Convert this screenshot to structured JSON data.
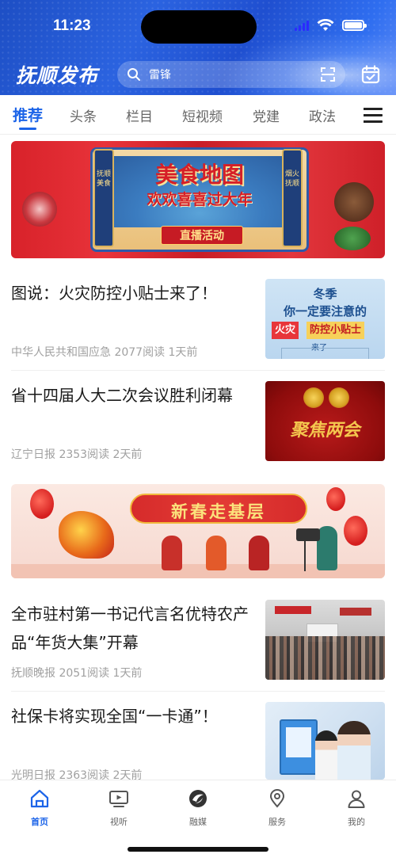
{
  "status_bar": {
    "time": "11:23"
  },
  "header": {
    "logo_text": "抚顺发布",
    "search": {
      "query": "雷锋",
      "icon": "search-icon"
    },
    "scan_icon": "scan-icon",
    "calendar_icon": "calendar-check-icon"
  },
  "tabs": {
    "items": [
      "推荐",
      "头条",
      "栏目",
      "短视频",
      "党建",
      "政法"
    ],
    "active_index": 0,
    "menu_icon": "menu-list-icon",
    "accent_color": "#1c64e8"
  },
  "feed": {
    "banner1": {
      "title": "美食地图",
      "subtitle": "欢欢喜喜过大年",
      "ribbon": "直播活动",
      "side_left": "抚顺美食",
      "side_right": "烟火抚顺"
    },
    "articles": [
      {
        "title": "图说：火灾防控小贴士来了！",
        "meta": "中华人民共和国应急 2077阅读 1天前",
        "thumb": {
          "line1": "冬季",
          "line2": "你一定要注意的",
          "tag_red": "火灾",
          "tag_yellow": "防控小贴士",
          "small": "来了"
        }
      },
      {
        "title": "省十四届人大二次会议胜利闭幕",
        "meta": "辽宁日报 2353阅读 2天前",
        "thumb": {
          "caption": "聚焦两会"
        }
      },
      {
        "title": "全市驻村第一书记代言名优特农产品“年货大集”开幕",
        "meta": "抚顺晚报 2051阅读 1天前",
        "thumb": {}
      },
      {
        "title": "社保卡将实现全国“一卡通”！",
        "meta": "光明日报 2363阅读 2天前",
        "thumb": {}
      }
    ],
    "banner2": {
      "title": "新春走基层"
    }
  },
  "bottom_nav": {
    "items": [
      {
        "label": "首页",
        "icon": "home-icon"
      },
      {
        "label": "视听",
        "icon": "tv-icon"
      },
      {
        "label": "融媒",
        "icon": "media-logo-icon"
      },
      {
        "label": "服务",
        "icon": "location-pin-icon"
      },
      {
        "label": "我的",
        "icon": "user-icon"
      }
    ],
    "active_index": 0
  }
}
